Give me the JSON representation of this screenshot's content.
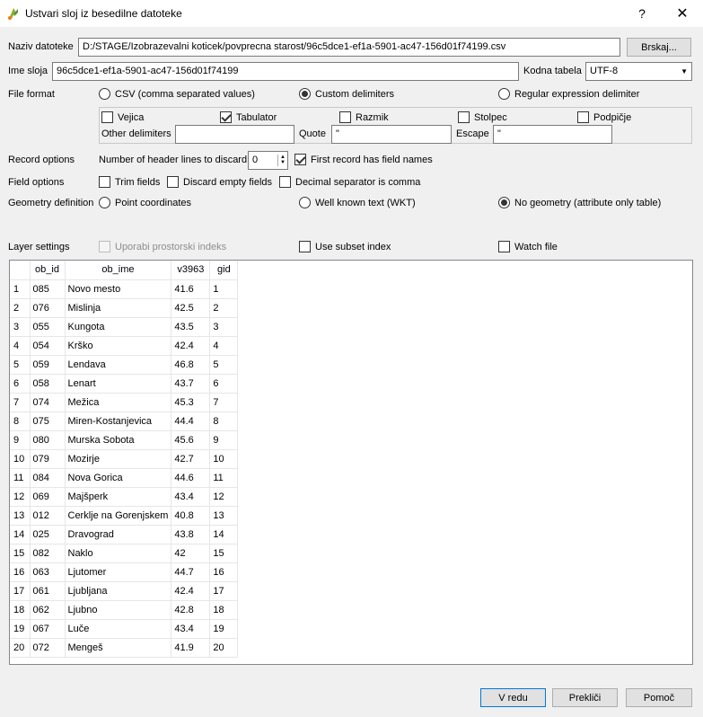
{
  "window": {
    "title": "Ustvari sloj iz besedilne datoteke",
    "help_glyph": "?",
    "close_glyph": "✕",
    "app_icon": "qgis-icon"
  },
  "file": {
    "label": "Naziv datoteke",
    "value": "D:/STAGE/Izobrazevalni koticek/povprecna starost/96c5dce1-ef1a-5901-ac47-156d01f74199.csv",
    "browse_label": "Brskaj..."
  },
  "layer": {
    "label": "Ime sloja",
    "value": "96c5dce1-ef1a-5901-ac47-156d01f74199",
    "encoding_label": "Kodna tabela",
    "encoding_value": "UTF-8"
  },
  "file_format": {
    "label": "File format",
    "csv": "CSV (comma separated values)",
    "custom": "Custom delimiters",
    "regex": "Regular expression delimiter",
    "selected": "custom"
  },
  "delimiters": {
    "vejica": "Vejica",
    "tabulator": "Tabulator",
    "razmik": "Razmik",
    "stolpec": "Stolpec",
    "podpicje": "Podpičje",
    "other_label": "Other delimiters",
    "other_value": "",
    "quote_label": "Quote",
    "quote_value": "\"",
    "escape_label": "Escape",
    "escape_value": "\""
  },
  "record_options": {
    "label": "Record options",
    "header_lines_label": "Number of header lines to discard",
    "header_lines_value": "0",
    "first_record_label": "First record has field names"
  },
  "field_options": {
    "label": "Field options",
    "trim": "Trim fields",
    "discard_empty": "Discard empty fields",
    "decimal_comma": "Decimal separator is comma"
  },
  "geometry": {
    "label": "Geometry definition",
    "point": "Point coordinates",
    "wkt": "Well known text (WKT)",
    "none": "No geometry (attribute only table)",
    "selected": "none"
  },
  "layer_settings": {
    "label": "Layer settings",
    "spatial_index": "Uporabi prostorski indeks",
    "subset_index": "Use subset index",
    "watch_file": "Watch file"
  },
  "table": {
    "columns": [
      "ob_id",
      "ob_ime",
      "v3963",
      "gid"
    ],
    "rows": [
      [
        "1",
        "085",
        "Novo mesto",
        "41.6",
        "1"
      ],
      [
        "2",
        "076",
        "Mislinja",
        "42.5",
        "2"
      ],
      [
        "3",
        "055",
        "Kungota",
        "43.5",
        "3"
      ],
      [
        "4",
        "054",
        "Krško",
        "42.4",
        "4"
      ],
      [
        "5",
        "059",
        "Lendava",
        "46.8",
        "5"
      ],
      [
        "6",
        "058",
        "Lenart",
        "43.7",
        "6"
      ],
      [
        "7",
        "074",
        "Mežica",
        "45.3",
        "7"
      ],
      [
        "8",
        "075",
        "Miren-Kostanjevica",
        "44.4",
        "8"
      ],
      [
        "9",
        "080",
        "Murska Sobota",
        "45.6",
        "9"
      ],
      [
        "10",
        "079",
        "Mozirje",
        "42.7",
        "10"
      ],
      [
        "11",
        "084",
        "Nova Gorica",
        "44.6",
        "11"
      ],
      [
        "12",
        "069",
        "Majšperk",
        "43.4",
        "12"
      ],
      [
        "13",
        "012",
        "Cerklje na Gorenjskem",
        "40.8",
        "13"
      ],
      [
        "14",
        "025",
        "Dravograd",
        "43.8",
        "14"
      ],
      [
        "15",
        "082",
        "Naklo",
        "42",
        "15"
      ],
      [
        "16",
        "063",
        "Ljutomer",
        "44.7",
        "16"
      ],
      [
        "17",
        "061",
        "Ljubljana",
        "42.4",
        "17"
      ],
      [
        "18",
        "062",
        "Ljubno",
        "42.8",
        "18"
      ],
      [
        "19",
        "067",
        "Luče",
        "43.4",
        "19"
      ],
      [
        "20",
        "072",
        "Mengeš",
        "41.9",
        "20"
      ]
    ]
  },
  "buttons": {
    "ok": "V redu",
    "cancel": "Prekliči",
    "help": "Pomoč"
  }
}
